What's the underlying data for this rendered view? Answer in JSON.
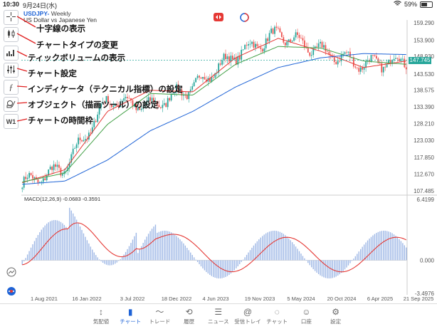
{
  "status": {
    "time": "10:30",
    "date": "9月24日(水)",
    "battery": "59%",
    "wifi_icon": "wifi-icon"
  },
  "symbol": {
    "code": "USDJPY-",
    "period": "Weekly",
    "name": "US Dollar vs Japanese Yen"
  },
  "annotations": [
    "十字線の表示",
    "チャートタイプの変更",
    "ティックボリュームの表示",
    "チャート設定",
    "インディケータ（テクニカル指標）の設定",
    "オブジェクト（描画ツール）の設定",
    "チャートの時間枠"
  ],
  "timeframe_label": "W1",
  "price_axis": [
    "159.290",
    "153.900",
    "148.930",
    "143.530",
    "138.575",
    "133.390",
    "128.210",
    "123.030",
    "117.850",
    "112.670",
    "107.485"
  ],
  "current_price": "147.745",
  "macd": {
    "label": "MACD(12,26,9) -0.0683 -0.3591",
    "axis": [
      "6.4199",
      "0.000",
      "-3.4976"
    ]
  },
  "time_axis": [
    "1 Aug 2021",
    "16 Jan 2022",
    "3 Jul 2022",
    "18 Dec 2022",
    "4 Jun 2023",
    "19 Nov 2023",
    "5 May 2024",
    "20 Oct 2024",
    "6 Apr 2025",
    "21 Sep 2025"
  ],
  "tabs": [
    "気配値",
    "チャート",
    "トレード",
    "履歴",
    "ニュース",
    "受信トレイ",
    "チャット",
    "口座",
    "設定"
  ],
  "active_tab": "チャート",
  "colors": {
    "up": "#26a69a",
    "down": "#ef5350",
    "ma_fast": "#e53935",
    "ma_mid": "#43a047",
    "ma_slow": "#1e63d6",
    "macd_hist": "#9fb8e6",
    "signal": "#e53935",
    "accent": "#1e63d6"
  },
  "chart_data": {
    "type": "candlestick",
    "x": [
      "1 Aug 2021",
      "16 Jan 2022",
      "3 Jul 2022",
      "18 Dec 2022",
      "4 Jun 2023",
      "19 Nov 2023",
      "5 May 2024",
      "20 Oct 2024",
      "6 Apr 2025",
      "21 Sep 2025"
    ],
    "close": [
      109.7,
      114.5,
      135.5,
      133.5,
      139.5,
      149.5,
      155.8,
      150.5,
      146.5,
      147.7
    ],
    "series": [
      {
        "values": [
          110.0,
          114.0,
          132.0,
          138.5,
          138.0,
          148.5,
          154.5,
          150.5,
          145.5,
          147.5
        ]
      },
      {
        "values": [
          110.2,
          113.0,
          128.0,
          137.5,
          137.0,
          146.5,
          152.0,
          151.5,
          147.5,
          146.5
        ]
      },
      {
        "values": [
          109.5,
          110.5,
          117.0,
          126.0,
          132.0,
          139.5,
          145.5,
          148.5,
          149.8,
          149.5
        ]
      }
    ],
    "ylim": [
      107.485,
      159.29
    ],
    "macd_ylim": [
      -3.4976,
      6.4199
    ]
  }
}
